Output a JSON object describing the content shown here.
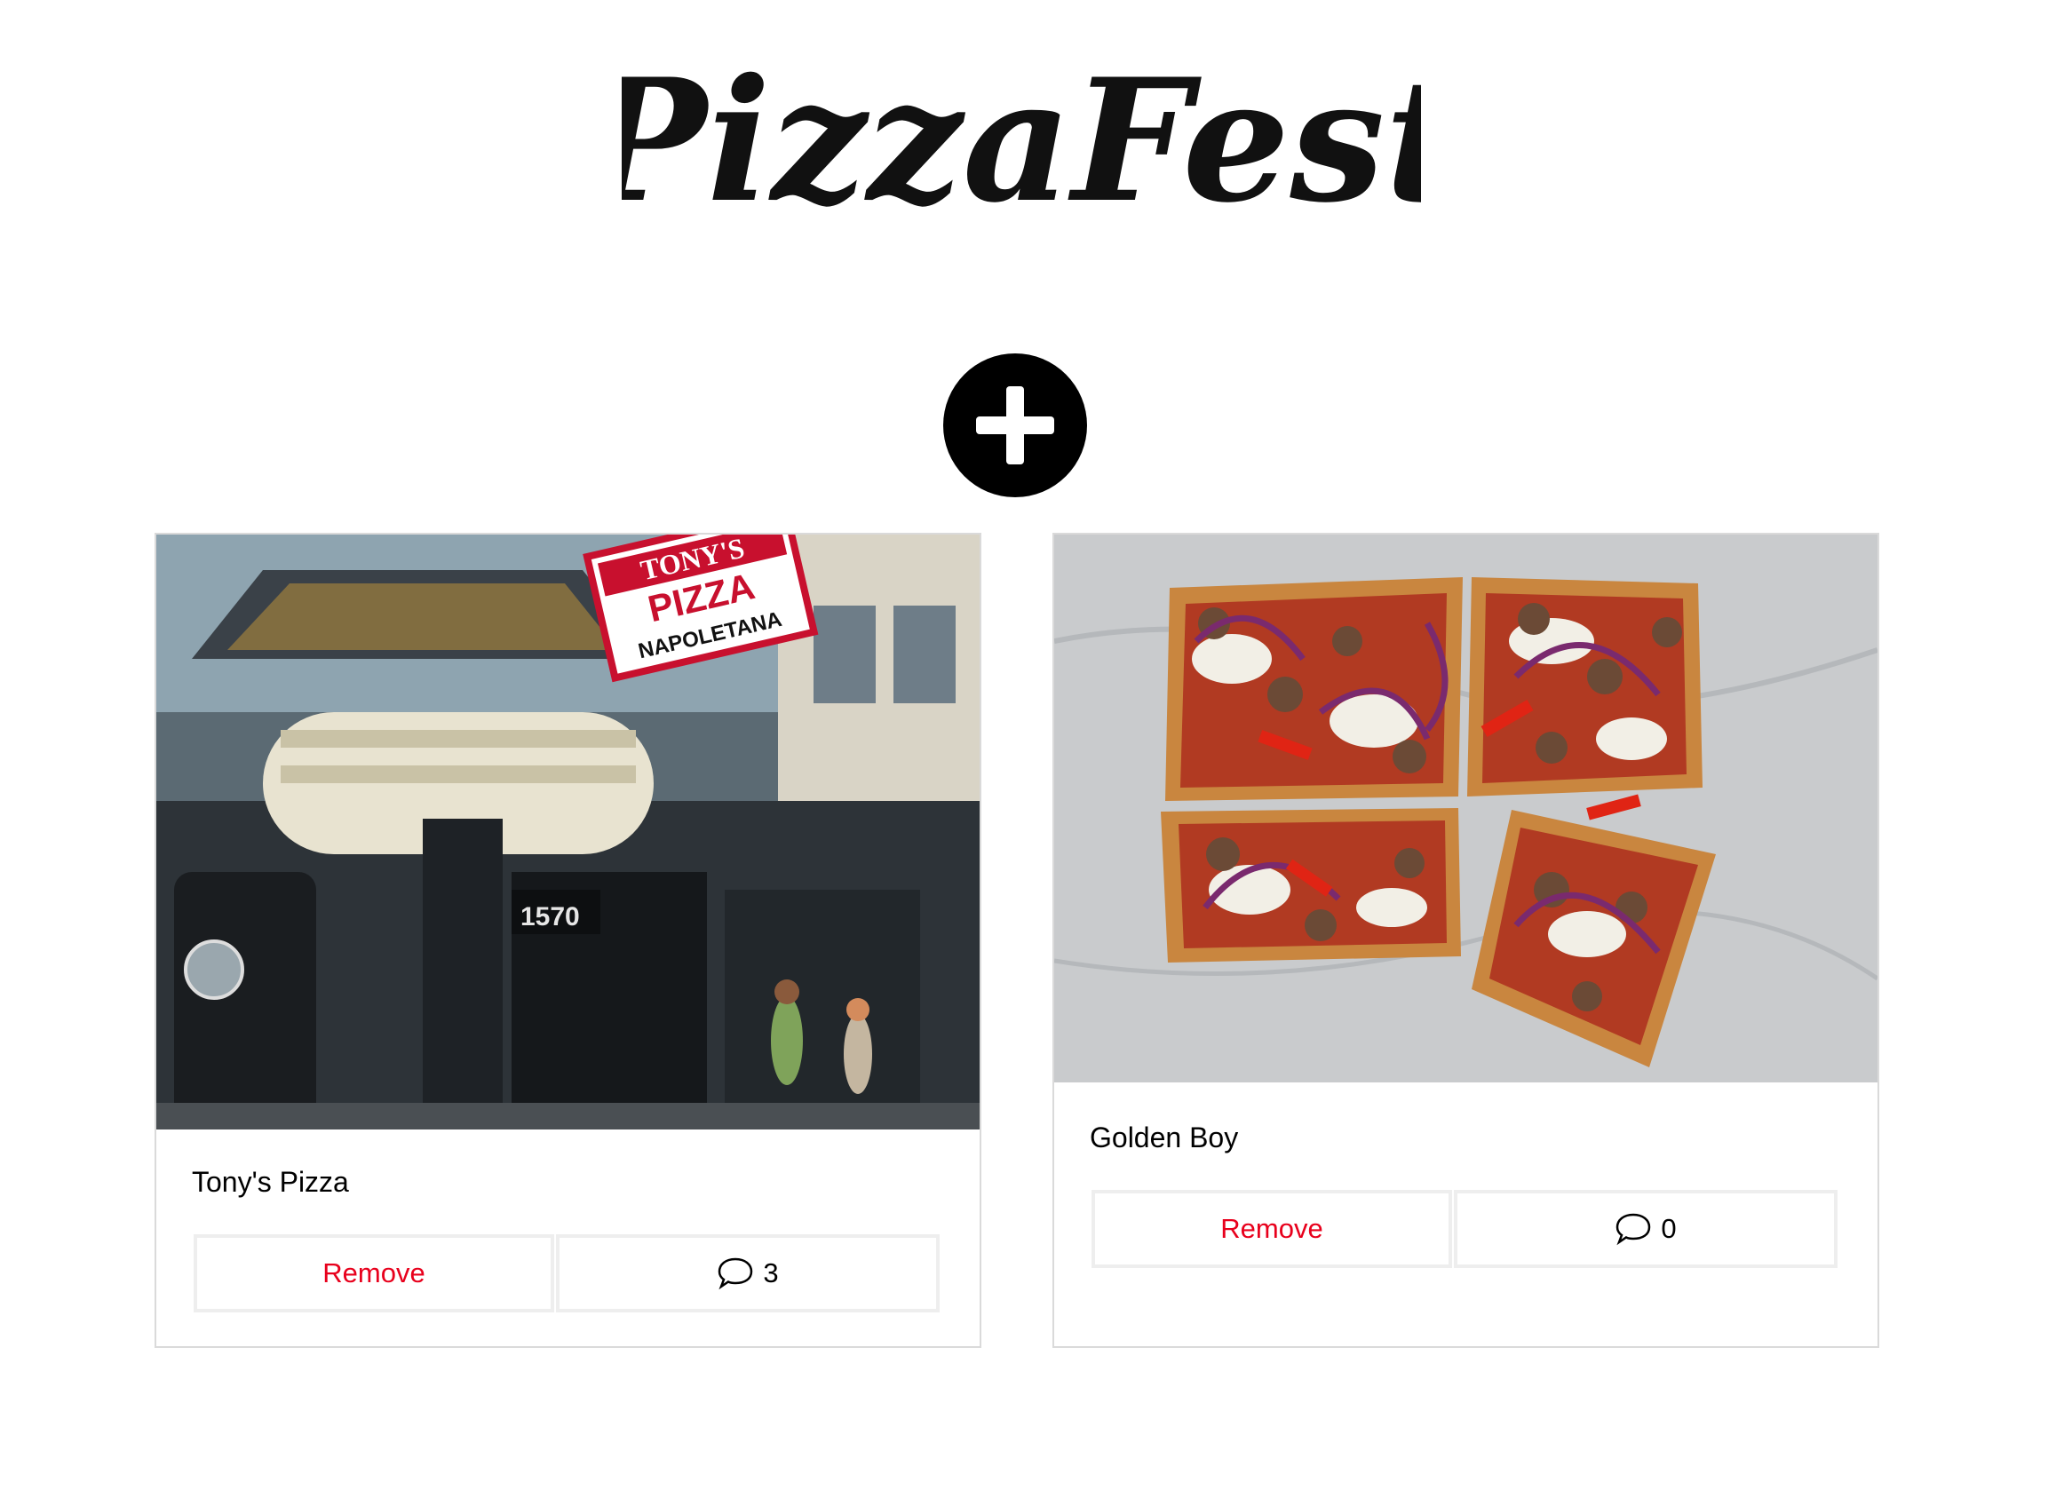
{
  "header": {
    "logo_text": "PizzaFest",
    "add_button_label": "+"
  },
  "cards": [
    {
      "title": "Tony's Pizza",
      "image_alt": "Tony's Pizza Napoletana storefront",
      "sign": {
        "line1": "TONY'S",
        "line2": "PIZZA",
        "line3": "NAPOLETANA"
      },
      "address_number": "1570",
      "remove_label": "Remove",
      "comment_count": "3"
    },
    {
      "title": "Golden Boy",
      "image_alt": "Square pizza with sausage, red peppers and onions",
      "remove_label": "Remove",
      "comment_count": "0"
    }
  ],
  "icons": {
    "add": "plus-icon",
    "comment": "speech-bubble-icon"
  },
  "colors": {
    "remove_text": "#e8001c",
    "card_border": "#dadada",
    "button_border": "#eeeeee",
    "add_button": "#000000"
  }
}
